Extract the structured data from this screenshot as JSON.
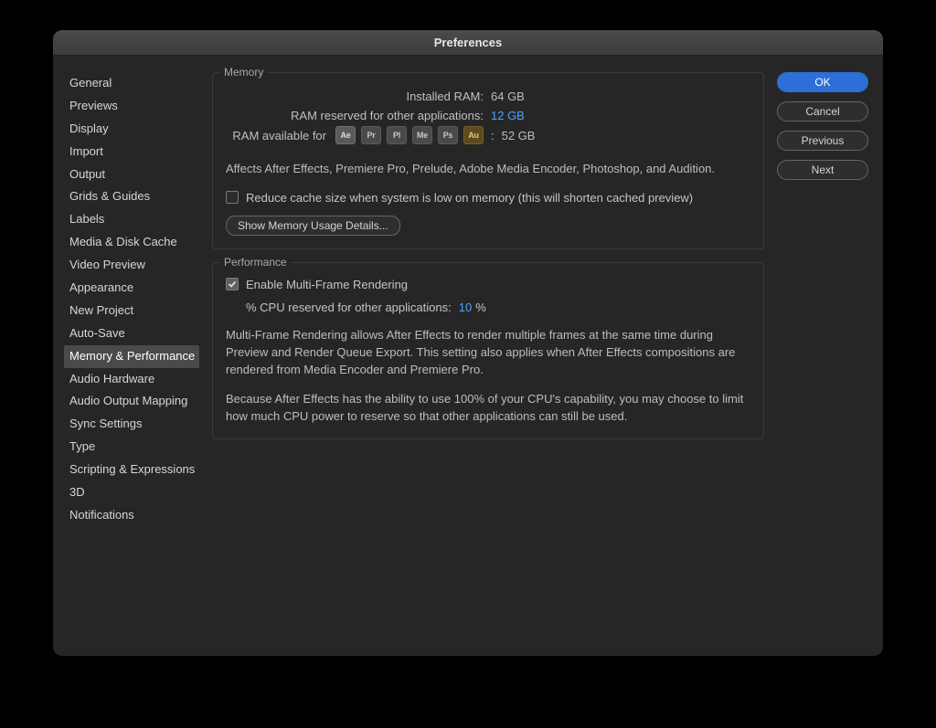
{
  "title": "Preferences",
  "sidebar": {
    "items": [
      {
        "label": "General"
      },
      {
        "label": "Previews"
      },
      {
        "label": "Display"
      },
      {
        "label": "Import"
      },
      {
        "label": "Output"
      },
      {
        "label": "Grids & Guides"
      },
      {
        "label": "Labels"
      },
      {
        "label": "Media & Disk Cache"
      },
      {
        "label": "Video Preview"
      },
      {
        "label": "Appearance"
      },
      {
        "label": "New Project"
      },
      {
        "label": "Auto-Save"
      },
      {
        "label": "Memory & Performance"
      },
      {
        "label": "Audio Hardware"
      },
      {
        "label": "Audio Output Mapping"
      },
      {
        "label": "Sync Settings"
      },
      {
        "label": "Type"
      },
      {
        "label": "Scripting & Expressions"
      },
      {
        "label": "3D"
      },
      {
        "label": "Notifications"
      }
    ],
    "selectedIndex": 12
  },
  "memory": {
    "title": "Memory",
    "installedLabel": "Installed RAM:",
    "installedValue": "64 GB",
    "reservedLabel": "RAM reserved for other applications:",
    "reservedValue": "12 GB",
    "availableLabel": "RAM available for",
    "apps": [
      "Ae",
      "Pr",
      "Pl",
      "Me",
      "Ps",
      "Au"
    ],
    "availableValue": "52 GB",
    "description": "Affects After Effects, Premiere Pro, Prelude, Adobe Media Encoder, Photoshop, and Audition.",
    "reduceCacheLabel": "Reduce cache size when system is low on memory (this will shorten cached preview)",
    "reduceCacheChecked": false,
    "detailsBtn": "Show Memory Usage Details..."
  },
  "performance": {
    "title": "Performance",
    "enableMFRLabel": "Enable Multi-Frame Rendering",
    "enableMFRChecked": true,
    "cpuReservedLabel": "% CPU reserved for other applications:",
    "cpuReservedValue": "10",
    "cpuReservedSuffix": "%",
    "desc1": "Multi-Frame Rendering allows After Effects to render multiple frames at the same time during Preview and Render Queue Export. This setting also applies when After Effects compositions are rendered from Media Encoder and Premiere Pro.",
    "desc2": "Because After Effects has the ability to use 100% of your CPU's capability, you may choose to limit how much CPU power to reserve so that other applications can still be used."
  },
  "buttons": {
    "ok": "OK",
    "cancel": "Cancel",
    "previous": "Previous",
    "next": "Next"
  }
}
